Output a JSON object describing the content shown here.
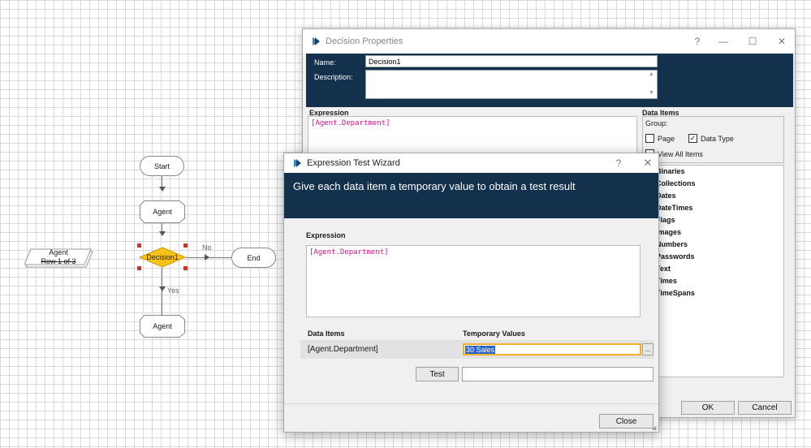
{
  "flowchart": {
    "start_label": "Start",
    "agent_top_label": "Agent",
    "decision_label": "Decision1",
    "end_label": "End",
    "agent_bottom_label": "Agent",
    "no_label": "No",
    "yes_label": "Yes",
    "collection_label_line1": "Agent",
    "collection_label_line2": "Row 1 of 3"
  },
  "decision_properties": {
    "title": "Decision Properties",
    "help_label": "?",
    "minimize_label": "—",
    "maximize_label": "☐",
    "close_label": "✕",
    "name_label": "Name:",
    "name_value": "Decision1",
    "description_label": "Description:",
    "description_value": "",
    "expression_header": "Expression",
    "expression_text": "[Agent.Department]",
    "data_items_header": "Data Items",
    "group_label": "Group:",
    "page_checkbox_label": "Page",
    "datatype_checkbox_label": "Data Type",
    "view_all_label": "View All Items",
    "page_checked": false,
    "datatype_checked": true,
    "tree_items": [
      "Binaries",
      "Collections",
      "Dates",
      "DateTimes",
      "Flags",
      "Images",
      "Numbers",
      "Passwords",
      "Text",
      "Times",
      "TimeSpans"
    ],
    "ok_label": "OK",
    "cancel_label": "Cancel"
  },
  "wizard": {
    "title": "Expression Test Wizard",
    "help_label": "?",
    "close_label": "✕",
    "banner_text": "Give each data item a temporary value to obtain a test result",
    "expression_header": "Expression",
    "expression_text": "[Agent.Department]",
    "data_items_header": "Data Items",
    "temp_values_header": "Temporary Values",
    "data_item_name": "[Agent.Department]",
    "temp_value": "30 Sales",
    "ellipsis_label": "...",
    "test_button_label": "Test",
    "result_value": "",
    "close_button_label": "Close"
  },
  "colors": {
    "navy": "#13304d",
    "decision_fill": "#f7c31a",
    "expression_text": "#d0198b",
    "selection_border": "#f0b030"
  }
}
